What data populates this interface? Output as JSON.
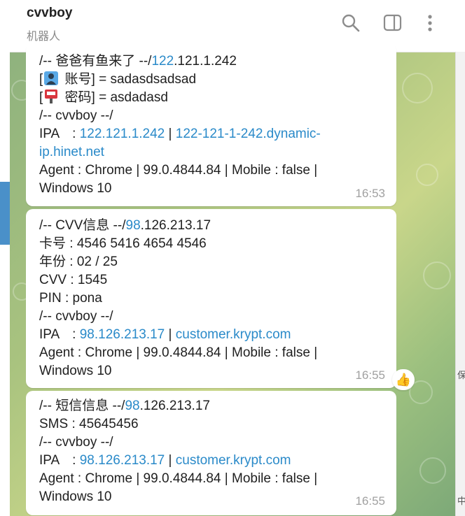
{
  "header": {
    "title": "cvvboy",
    "subtitle": "机器人"
  },
  "messages": [
    {
      "lines": {
        "l1_pre": "/-- 爸爸有鱼来了 --/",
        "l1_link": "122",
        "l1_post": ".121.1.242",
        "l2_open": "[",
        "l2_text": " 账号] = sadasdsadsad",
        "l3_open": "[",
        "l3_text": " 密码] = asdadasd",
        "l4": "/-- cvvboy --/",
        "l5_label": "IPA　: ",
        "l5_ip": "122.121.1.242",
        "l5_sep": " | ",
        "l5_host_a": "122-121-1-242.dynamic-",
        "l6_host_b": "ip.hinet.net",
        "l7": "Agent : Chrome | 99.0.4844.84 | Mobile : false  |",
        "l8": "Windows 10"
      },
      "time": "16:53"
    },
    {
      "lines": {
        "l1_pre": "/-- CVV信息 --/",
        "l1_link": "98",
        "l1_post": ".126.213.17",
        "l2": "卡号 : 4546 5416 4654 4546",
        "l3": "年份 : 02 / 25",
        "l4": "CVV : 1545",
        "l5": "PIN : pona",
        "l6": "/-- cvvboy --/",
        "l7_label": "IPA　: ",
        "l7_ip": "98.126.213.17",
        "l7_sep": " | ",
        "l7_host": "customer.krypt.com",
        "l8": "Agent : Chrome | 99.0.4844.84 | Mobile : false  |",
        "l9": "Windows 10"
      },
      "time": "16:55",
      "reaction": "👍"
    },
    {
      "lines": {
        "l1_pre": "/-- 短信信息 --/",
        "l1_link": "98",
        "l1_post": ".126.213.17",
        "l2": "SMS : 45645456",
        "l3": "/-- cvvboy --/",
        "l4_label": "IPA　: ",
        "l4_ip": "98.126.213.17",
        "l4_sep": " | ",
        "l4_host": "customer.krypt.com",
        "l5": "Agent : Chrome | 99.0.4844.84 | Mobile : false  |",
        "l6": "Windows 10"
      },
      "time": "16:55"
    }
  ],
  "gutter": {
    "frag1": "保",
    "frag2": "中"
  },
  "icons": {
    "search": "search-icon",
    "sidebar": "sidebar-toggle-icon",
    "more": "more-vertical-icon",
    "user": "user-icon",
    "key": "password-icon"
  },
  "colors": {
    "link": "#2a8ac9",
    "accent": "#4a90c9"
  }
}
